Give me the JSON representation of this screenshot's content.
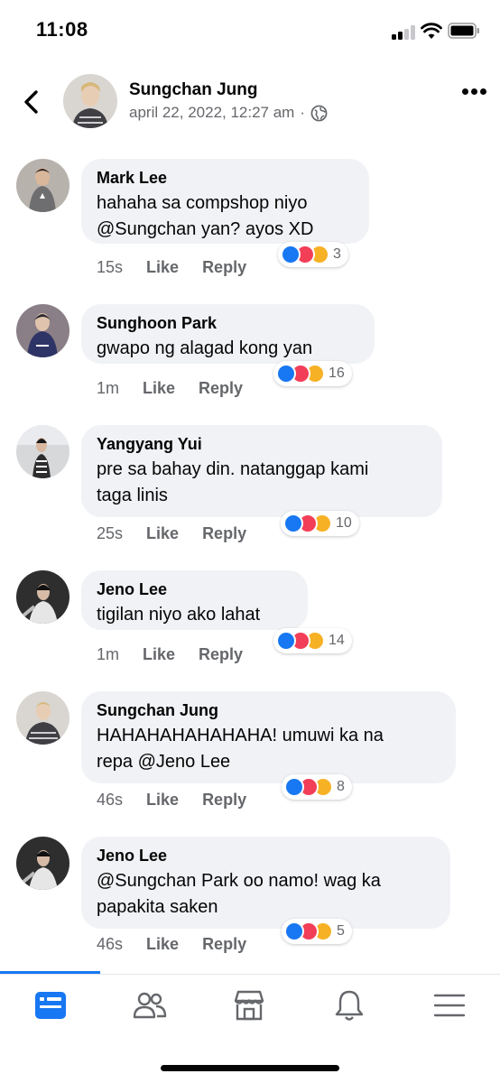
{
  "status_bar": {
    "time": "11:08"
  },
  "post": {
    "author": "Sungchan Jung",
    "timestamp": "april 22, 2022, 12:27 am",
    "separator": "·",
    "privacy_icon": "globe-icon"
  },
  "comments": [
    {
      "name": "Mark Lee",
      "text": "hahaha sa compshop niyo\n@Sungchan yan? ayos XD",
      "time": "15s",
      "like": "Like",
      "reply": "Reply",
      "reaction_count": "3",
      "avatar_color": "#b8b2ad"
    },
    {
      "name": "Sunghoon Park",
      "text": "gwapo ng alagad kong yan",
      "time": "1m",
      "like": "Like",
      "reply": "Reply",
      "reaction_count": "16",
      "avatar_color": "#6b5f73"
    },
    {
      "name": "Yangyang Yui",
      "text": "pre sa bahay din. natanggap kami\ntaga linis",
      "time": "25s",
      "like": "Like",
      "reply": "Reply",
      "reaction_count": "10",
      "avatar_color": "#c9cccf"
    },
    {
      "name": "Jeno Lee",
      "text": "tigilan niyo ako lahat",
      "time": "1m",
      "like": "Like",
      "reply": "Reply",
      "reaction_count": "14",
      "avatar_color": "#3a3a3a"
    },
    {
      "name": "Sungchan Jung",
      "text": "HAHAHAHAHAHAHA! umuwi ka na\nrepa @Jeno Lee",
      "time": "46s",
      "like": "Like",
      "reply": "Reply",
      "reaction_count": "8",
      "avatar_color": "#8c8275"
    },
    {
      "name": "Jeno Lee",
      "text": "@Sungchan Park oo namo! wag ka\npapakita saken",
      "time": "46s",
      "like": "Like",
      "reply": "Reply",
      "reaction_count": "5",
      "avatar_color": "#3a3a3a"
    }
  ],
  "reactions": [
    "like-icon",
    "love-icon",
    "haha-icon"
  ],
  "bottom_nav": [
    "feed-icon",
    "friends-icon",
    "marketplace-icon",
    "notifications-icon",
    "menu-icon"
  ],
  "colors": {
    "brand": "#1877f2",
    "bubble": "#f0f2f5",
    "secondary_text": "#65676b",
    "love": "#f33e58",
    "haha": "#f7b125"
  }
}
